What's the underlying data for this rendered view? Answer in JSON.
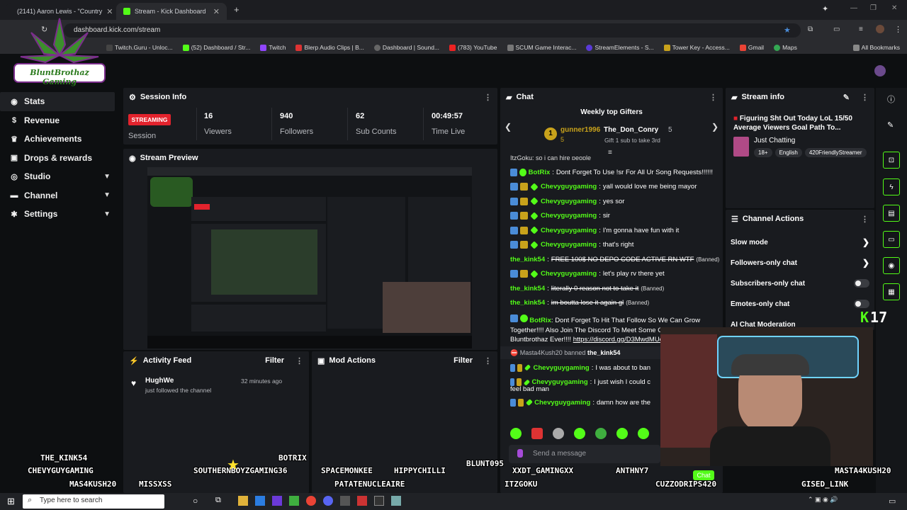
{
  "browser": {
    "tabs": [
      {
        "label": "(2141) Aaron Lewis - \"Country"
      },
      {
        "label": "Stream - Kick Dashboard"
      }
    ],
    "url": "dashboard.kick.com/stream",
    "bookmarks": [
      "Twitch.Guru - Unloc...",
      "(52) Dashboard / Str...",
      "Twitch",
      "Blerp Audio Clips | B...",
      "Dashboard | Sound...",
      "(783) YouTube",
      "SCUM Game Interac...",
      "StreamElements - S...",
      "Tower Key - Access...",
      "Gmail",
      "Maps"
    ],
    "all_bookmarks": "All Bookmarks"
  },
  "logo_text": "BluntBrothaz Gaming",
  "nav": {
    "items": [
      {
        "label": "Stats",
        "icon": "pulse-icon"
      },
      {
        "label": "Revenue",
        "icon": "dollar-icon"
      },
      {
        "label": "Achievements",
        "icon": "trophy-icon"
      },
      {
        "label": "Drops & rewards",
        "icon": "gift-icon"
      },
      {
        "label": "Studio",
        "icon": "video-icon"
      },
      {
        "label": "Channel",
        "icon": "user-icon"
      },
      {
        "label": "Settings",
        "icon": "gear-icon"
      }
    ]
  },
  "session": {
    "title": "Session Info",
    "status": "STREAMING",
    "status_label": "Session",
    "stats": [
      {
        "value": "16",
        "label": "Viewers"
      },
      {
        "value": "940",
        "label": "Followers"
      },
      {
        "value": "62",
        "label": "Sub Counts"
      },
      {
        "value": "00:49:57",
        "label": "Time Live"
      }
    ]
  },
  "preview": {
    "title": "Stream Preview"
  },
  "activity": {
    "title": "Activity Feed",
    "filter": "Filter",
    "items": [
      {
        "user": "HughWe",
        "action": "just followed the channel",
        "time": "32 minutes ago"
      }
    ]
  },
  "mod_actions": {
    "title": "Mod Actions",
    "filter": "Filter"
  },
  "chat": {
    "title": "Chat",
    "gifters_title": "Weekly top Gifters",
    "gifter1": {
      "rank": "1",
      "name": "gunner1996",
      "count": "5"
    },
    "gifter2": {
      "name": "The_Don_Conry",
      "count": "5",
      "note": "Gift 1 sub to take 3rd"
    },
    "partial_top": "ItzGoku: so i can hire people",
    "messages": [
      {
        "user": "BotRix",
        "text": "Dont Forget To Use !sr For All Ur Song Requests!!!!!!"
      },
      {
        "user": "Chevyguygaming",
        "text": "yall would love me being mayor"
      },
      {
        "user": "Chevyguygaming",
        "text": "yes sor"
      },
      {
        "user": "Chevyguygaming",
        "text": "sir"
      },
      {
        "user": "Chevyguygaming",
        "text": "I'm gonna have fun with it"
      },
      {
        "user": "Chevyguygaming",
        "text": "that's right"
      },
      {
        "user": "the_kink54",
        "text": "FREE 100$ NO DEPO CODE ACTIVE RN WTF",
        "tag": "(Banned)"
      },
      {
        "user": "Chevyguygaming",
        "text": "let's play rv there yet"
      },
      {
        "user": "the_kink54",
        "text": "literally 0 reason not to take it",
        "tag": "(Banned)"
      },
      {
        "user": "the_kink54",
        "text": "im boutta lose it again gl",
        "tag": "(Banned)"
      }
    ],
    "botrix_long": "Dont Forget To Hit That Follow So We Can Grow Together!!!! Also Join The Discord To Meet Some Of The Bluntbrothaz Ever!!!!",
    "discord_link": "https://discord.gg/D3MwdMUezf",
    "ban_notice": {
      "mod": "Masta4Kush20",
      "action": "banned",
      "target": "the_kink54"
    },
    "messages2": [
      {
        "user": "Chevyguygaming",
        "text": "I was about to ban"
      },
      {
        "user": "Chevyguygaming",
        "text": "I just wish I could c",
        "cont": "feel bad man"
      },
      {
        "user": "Chevyguygaming",
        "text": "damn how are the"
      }
    ],
    "input_placeholder": "Send a message",
    "chat_button": "Chat"
  },
  "stream_info": {
    "title": "Stream info",
    "stream_title": "Figuring Sht Out Today LoL  15/50 Average Viewers Goal  Path To...",
    "category": "Just Chatting",
    "tags": [
      "18+",
      "English",
      "420FriendlyStreamer"
    ]
  },
  "channel_actions": {
    "title": "Channel Actions",
    "items": [
      {
        "label": "Slow mode",
        "type": "chevron"
      },
      {
        "label": "Followers-only chat",
        "type": "chevron"
      },
      {
        "label": "Subscribers-only chat",
        "type": "toggle"
      },
      {
        "label": "Emotes-only chat",
        "type": "toggle"
      },
      {
        "label": "AI Chat Moderation",
        "type": "none"
      }
    ]
  },
  "overlay": {
    "kick_count": "17",
    "names": [
      "THE_KINK54",
      "CHEVYGUYGAMING",
      "MAS4KUSH20",
      "MISSXSS",
      "BOTRIX",
      "SOUTHERNBOYZGAMING36",
      "SPACEMONKEE",
      "HIPPYCHILLI",
      "PATATENUCLEAIRE",
      "BLUNT095",
      "XXDT_GAMINGXX",
      "ITZGOKU",
      "ANTHNY7",
      "CUZZODRIPS420",
      "MASTA4KUSH20",
      "GISED_LINK"
    ]
  },
  "taskbar": {
    "search_placeholder": "Type here to search"
  }
}
